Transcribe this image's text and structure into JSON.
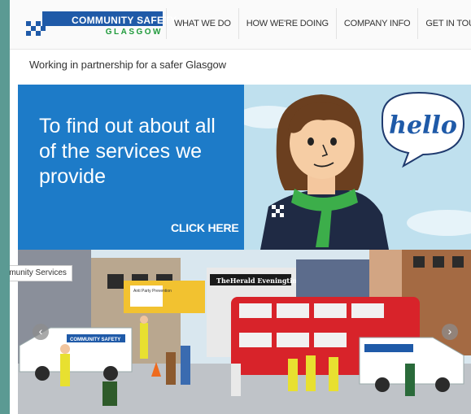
{
  "logo": {
    "main": "COMMUNITY SAFETY",
    "sub": "GLASGOW"
  },
  "nav": [
    {
      "label": "WHAT WE DO"
    },
    {
      "label": "HOW WE'RE DOING"
    },
    {
      "label": "COMPANY INFO"
    },
    {
      "label": "GET IN TOUCH"
    }
  ],
  "tagline": "Working in partnership for a safer Glasgow",
  "hero": {
    "headline": "To find out about all of the services we provide",
    "cta": "CLICK HERE",
    "speech": "hello"
  },
  "carousel": {
    "label": "mmunity Services",
    "prev_icon": "chevron-left-icon",
    "next_icon": "chevron-right-icon"
  },
  "scene": {
    "shop_sign": "TheHerald Eveningtimes",
    "van_text": "COMMUNITY SAFETY",
    "shop_small": "Anti Party Prevention"
  },
  "colors": {
    "brand_blue": "#1f5aa8",
    "brand_green": "#1f9a3b",
    "hero_blue": "#1d7bc8",
    "sky": "#bfe0ee",
    "bus_red": "#d8232a",
    "frame": "#5b9a93"
  }
}
